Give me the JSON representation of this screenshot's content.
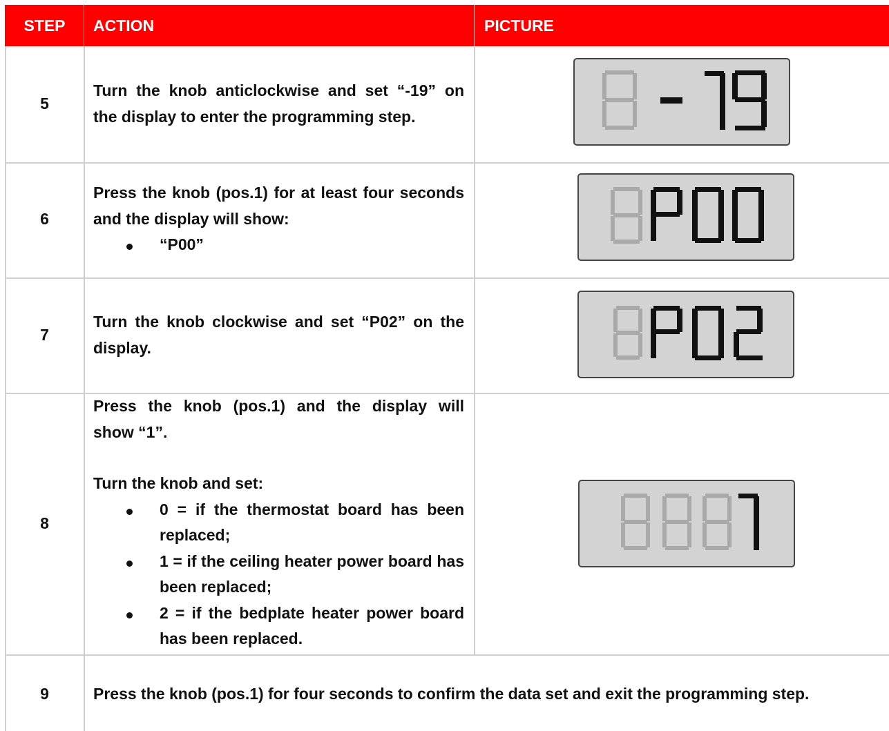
{
  "header": {
    "step": "STEP",
    "action": "ACTION",
    "picture": "PICTURE"
  },
  "steps": [
    {
      "number": "5",
      "lines": [
        "Turn the knob anticlockwise and set “-19” on",
        "the display to enter the programming step."
      ],
      "display": {
        "ghost_digits": 1,
        "text": "- 19"
      }
    },
    {
      "number": "6",
      "lines": [
        "Press the knob (pos.1) for at least four seconds",
        "and the display will show:"
      ],
      "bullets": [
        "“P00”"
      ],
      "display": {
        "ghost_digits": 1,
        "text": "P00"
      }
    },
    {
      "number": "7",
      "lines": [
        "Turn the knob clockwise and set “P02” on the",
        "display."
      ],
      "display": {
        "ghost_digits": 1,
        "text": "P02"
      }
    },
    {
      "number": "8",
      "lines": [
        "Press the knob (pos.1) and the display will",
        "show “1”."
      ],
      "subheading": "Turn the knob and set:",
      "bullets": [
        "0 = if the thermostat board has been replaced;",
        "1 = if the ceiling heater power board has been replaced;",
        "2 = if the bedplate heater power board has been replaced."
      ],
      "display": {
        "ghost_digits": 3,
        "text": "1"
      }
    },
    {
      "number": "9",
      "lines": [
        "Press the knob (pos.1) for four seconds to confirm the data set and exit the programming step."
      ]
    }
  ],
  "colors": {
    "header_bg": "#ff0000",
    "lcd_bg": "#d3d3d3",
    "lcd_ghost": "#a9a9a9",
    "lcd_on": "#111111"
  }
}
